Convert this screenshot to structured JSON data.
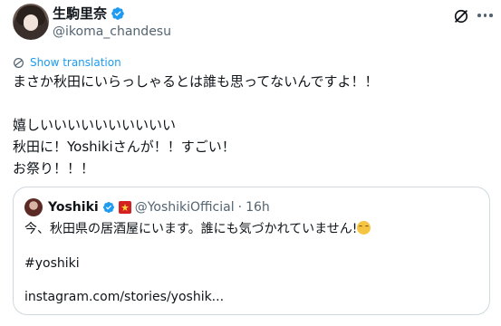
{
  "tweet": {
    "author_name": "生駒里奈",
    "author_handle": "@ikoma_chandesu",
    "show_translation": "Show translation",
    "body": "まさか秋田にいらっしゃるとは誰も思ってないんですよ！！\n\n嬉しいいいいいいいいいい\n秋田に！Yoshikiさんが！！すごい！\nお祭り！！！"
  },
  "quote": {
    "author_name": "Yoshiki",
    "author_handle": "@YoshikiOfficial",
    "separator": "·",
    "time": "16h",
    "text": "今、秋田県の居酒屋にいます。誰にも気づかれていません!",
    "hashtag": "#yoshiki",
    "link": "instagram.com/stories/yoshik..."
  },
  "icons": {
    "verified": "verified-badge-icon",
    "grok": "grok-icon",
    "more": "more-icon",
    "translate": "translate-icon",
    "flag": "japan-flag-badge-icon",
    "emoji": "smiling-face-emoji"
  },
  "colors": {
    "link_blue": "#1d9bf0",
    "verified_blue": "#1d9bf0",
    "text_primary": "#0f1419",
    "text_secondary": "#536471",
    "border": "#cfd9de"
  }
}
